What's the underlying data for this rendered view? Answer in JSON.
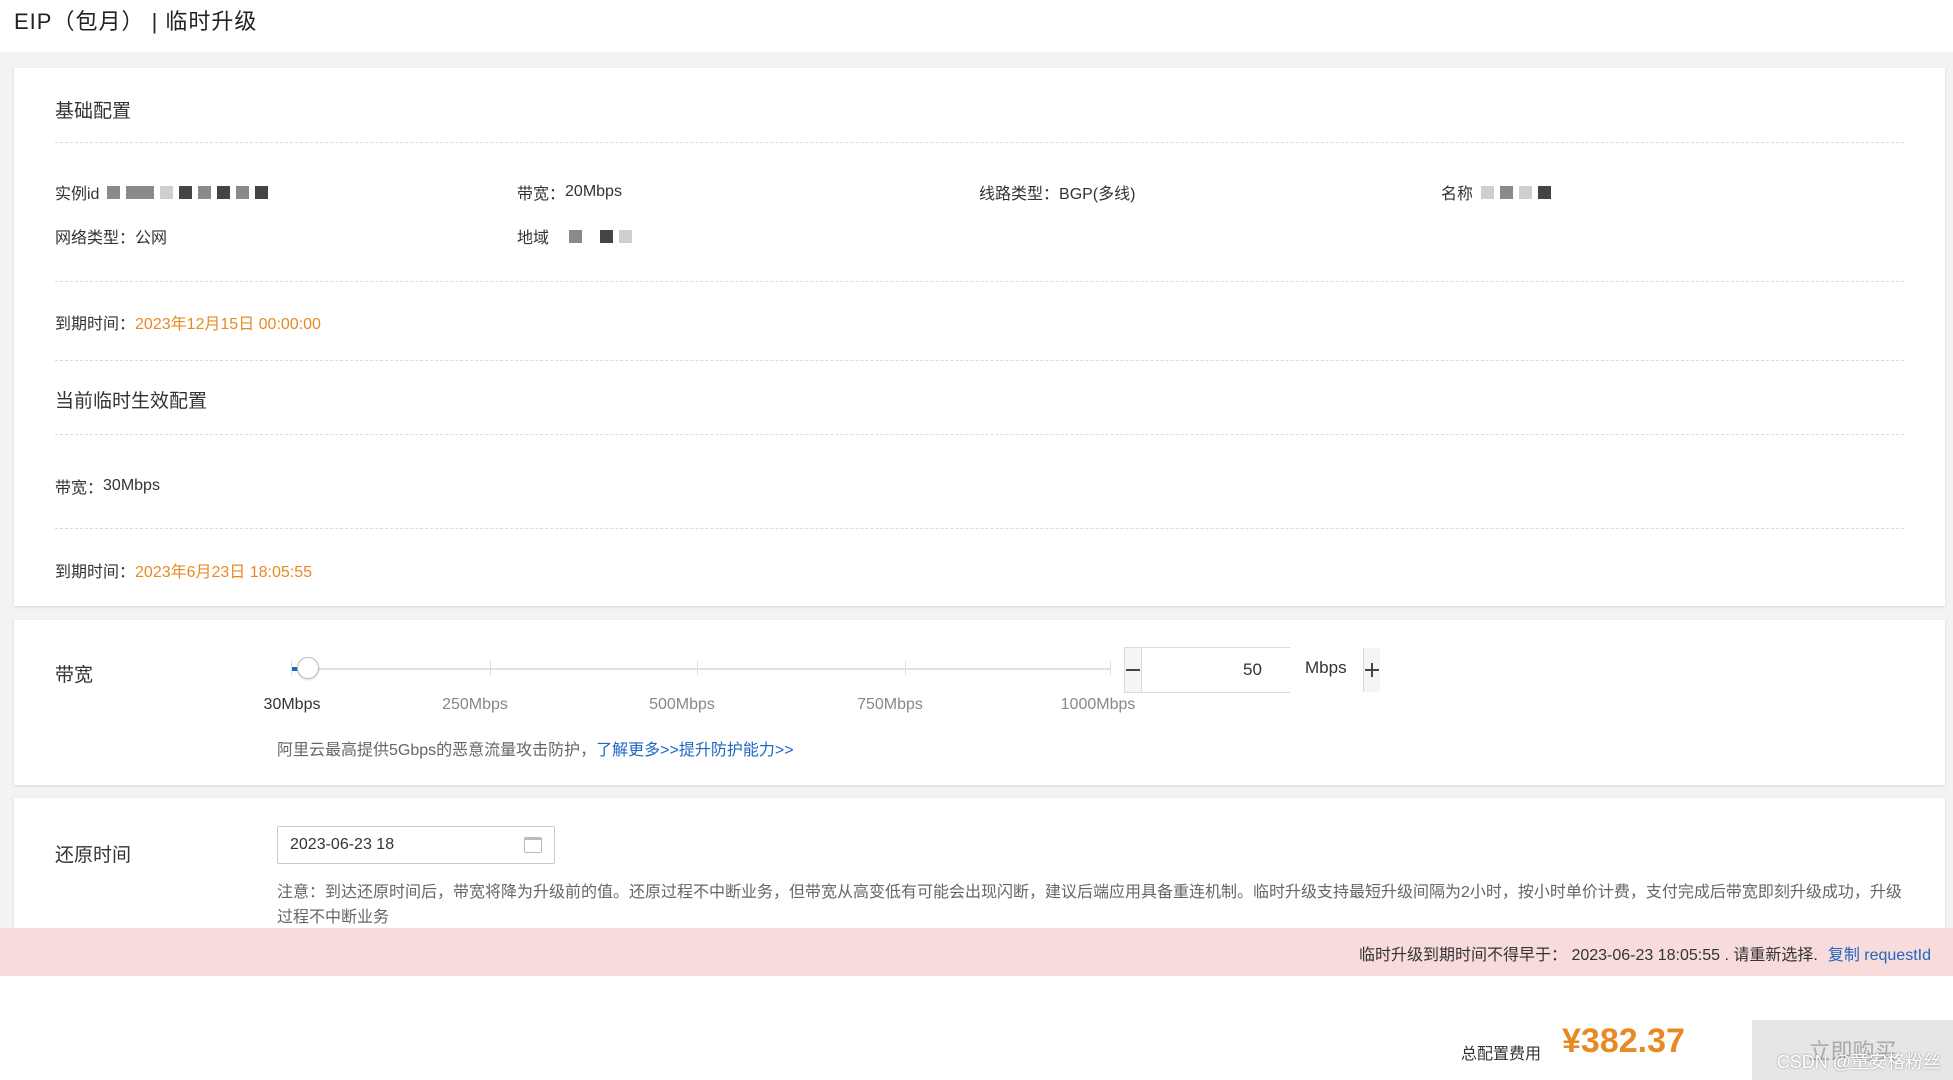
{
  "page": {
    "title": "EIP（包月） | 临时升级"
  },
  "basic": {
    "section_title": "基础配置",
    "instance_id_label": "实例id",
    "bandwidth_label": "带宽：",
    "bandwidth_value": "20Mbps",
    "line_type_label": "线路类型：",
    "line_type_value": "BGP(多线)",
    "name_label": "名称",
    "network_type_label": "网络类型：",
    "network_type_value": "公网",
    "region_label": "地域",
    "expire_label": "到期时间：",
    "expire_value": "2023年12月15日 00:00:00"
  },
  "current_temp": {
    "section_title": "当前临时生效配置",
    "bandwidth_label": "带宽：",
    "bandwidth_value": "30Mbps",
    "expire_label": "到期时间：",
    "expire_value": "2023年6月23日 18:05:55"
  },
  "bandwidth": {
    "label": "带宽",
    "slider_ticks": [
      "30Mbps",
      "250Mbps",
      "500Mbps",
      "750Mbps",
      "1000Mbps"
    ],
    "slider_min": 30,
    "slider_max": 1000,
    "current_value": "50",
    "unit": "Mbps",
    "protect_text": "阿里云最高提供5Gbps的恶意流量攻击防护，",
    "protect_link": "了解更多>>提升防护能力>>",
    "minus_icon": "minus-icon",
    "plus_icon": "plus-icon"
  },
  "restore": {
    "label": "还原时间",
    "date_value": "2023-06-23 18",
    "calendar_icon": "calendar-icon",
    "note": "注意：到达还原时间后，带宽将降为升级前的值。还原过程不中断业务，但带宽从高变低有可能会出现闪断，建议后端应用具备重连机制。临时升级支持最短升级间隔为2小时，按小时单价计费，支付完成后带宽即刻升级成功，升级过程不中断业务"
  },
  "error": {
    "message": "临时升级到期时间不得早于：  2023-06-23 18:05:55 . 请重新选择.",
    "copy_link": "复制 requestId",
    "background": "#f8dcdc"
  },
  "footer": {
    "total_label": "总配置费用",
    "total_price": "¥382.37",
    "buy_button": "立即购买",
    "watermark": "CSDN @童安格粉丝"
  },
  "colors": {
    "accent_orange": "#e88a24",
    "link_blue": "#1e66c2"
  }
}
